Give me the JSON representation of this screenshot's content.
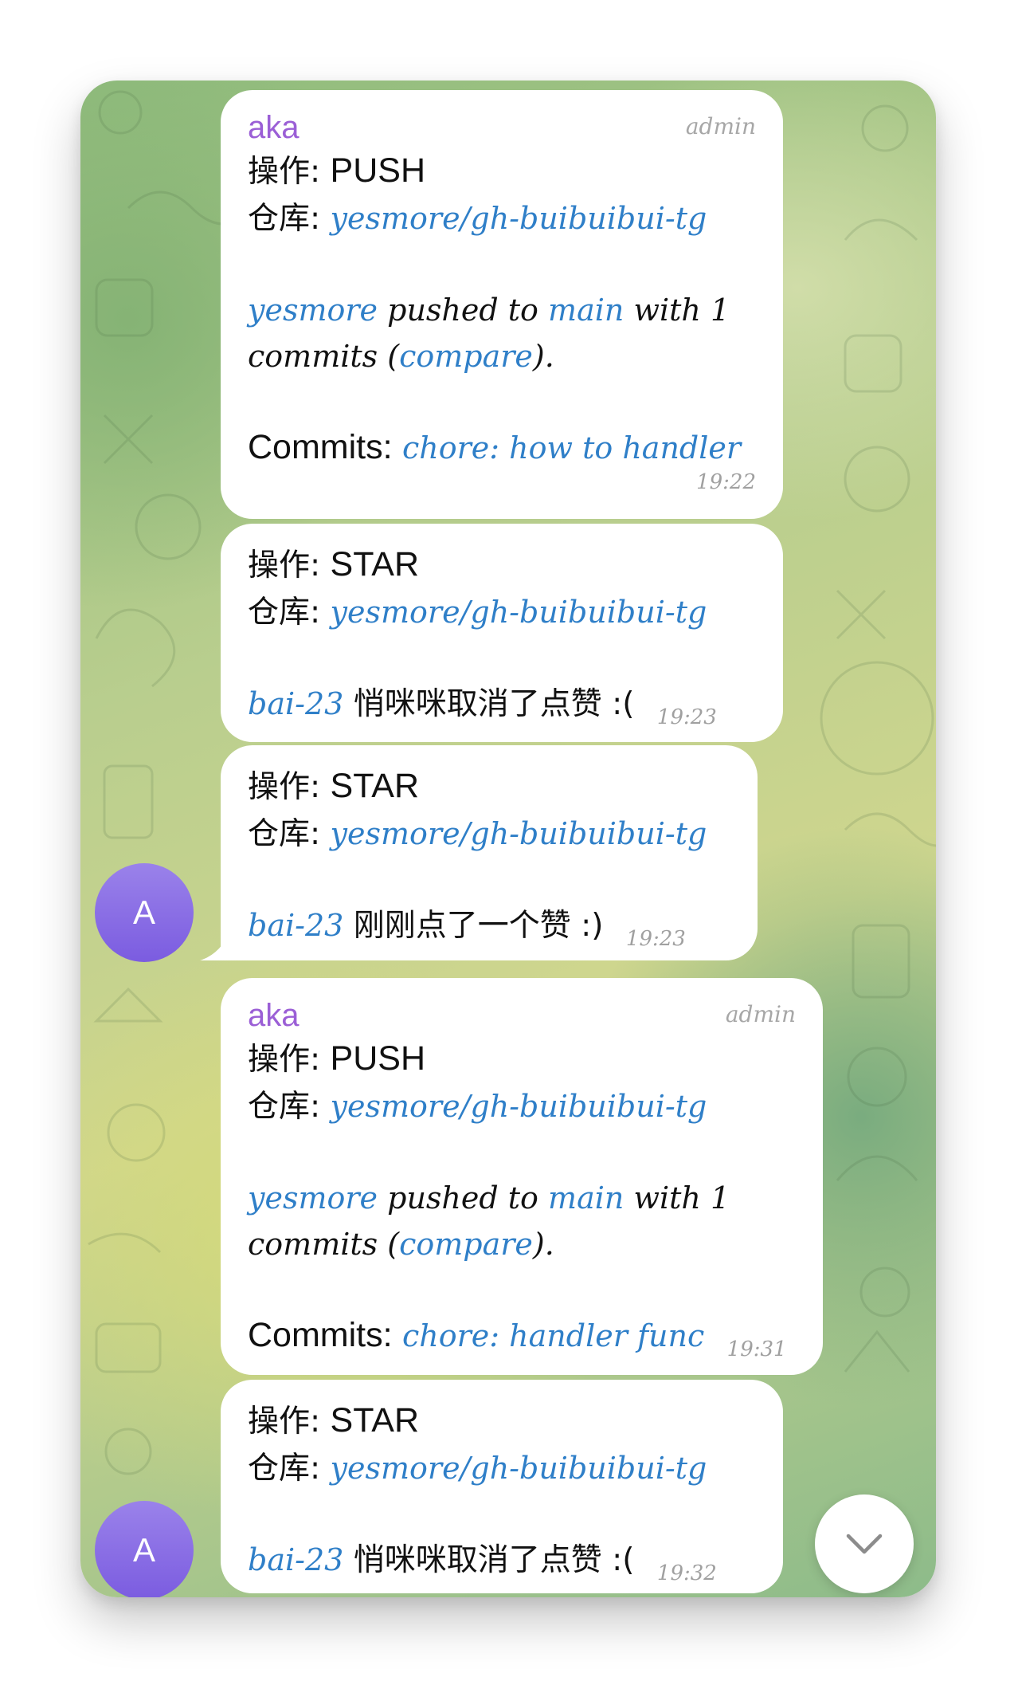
{
  "messages": [
    {
      "sender": "aka",
      "role": "admin",
      "op_label": "操作:",
      "op_value": "PUSH",
      "repo_label": "仓库:",
      "repo": "yesmore/gh-buibuibui-tg",
      "push_user": "yesmore",
      "push_mid": "pushed to",
      "push_branch": "main",
      "push_tail": "with 1",
      "commits_line": "commits (",
      "compare": "compare",
      "commits_end": ").",
      "commits_label": "Commits:",
      "commit_msg": "chore: how to handler",
      "time": "19:22"
    },
    {
      "op_label": "操作:",
      "op_value": "STAR",
      "repo_label": "仓库:",
      "repo": "yesmore/gh-buibuibui-tg",
      "user": "bai-23",
      "text": "悄咪咪取消了点赞 :(",
      "time": "19:23"
    },
    {
      "op_label": "操作:",
      "op_value": "STAR",
      "repo_label": "仓库:",
      "repo": "yesmore/gh-buibuibui-tg",
      "user": "bai-23",
      "text": "刚刚点了一个赞 :)",
      "time": "19:23"
    },
    {
      "sender": "aka",
      "role": "admin",
      "op_label": "操作:",
      "op_value": "PUSH",
      "repo_label": "仓库:",
      "repo": "yesmore/gh-buibuibui-tg",
      "push_user": "yesmore",
      "push_mid": "pushed to",
      "push_branch": "main",
      "push_tail": "with 1",
      "commits_line": "commits (",
      "compare": "compare",
      "commits_end": ").",
      "commits_label": "Commits:",
      "commit_msg": "chore: handler func",
      "time": "19:31"
    },
    {
      "op_label": "操作:",
      "op_value": "STAR",
      "repo_label": "仓库:",
      "repo": "yesmore/gh-buibuibui-tg",
      "user": "bai-23",
      "text": "悄咪咪取消了点赞 :(",
      "time": "19:32"
    }
  ],
  "avatars": [
    {
      "letter": "A"
    },
    {
      "letter": "A"
    }
  ],
  "colors": {
    "sender": "#9b5fd6",
    "link": "#2f7fc8",
    "avatar": "#8a6fe6",
    "timestamp": "#a0a0a0"
  },
  "icons": {
    "scroll_down": "chevron-down-icon"
  }
}
